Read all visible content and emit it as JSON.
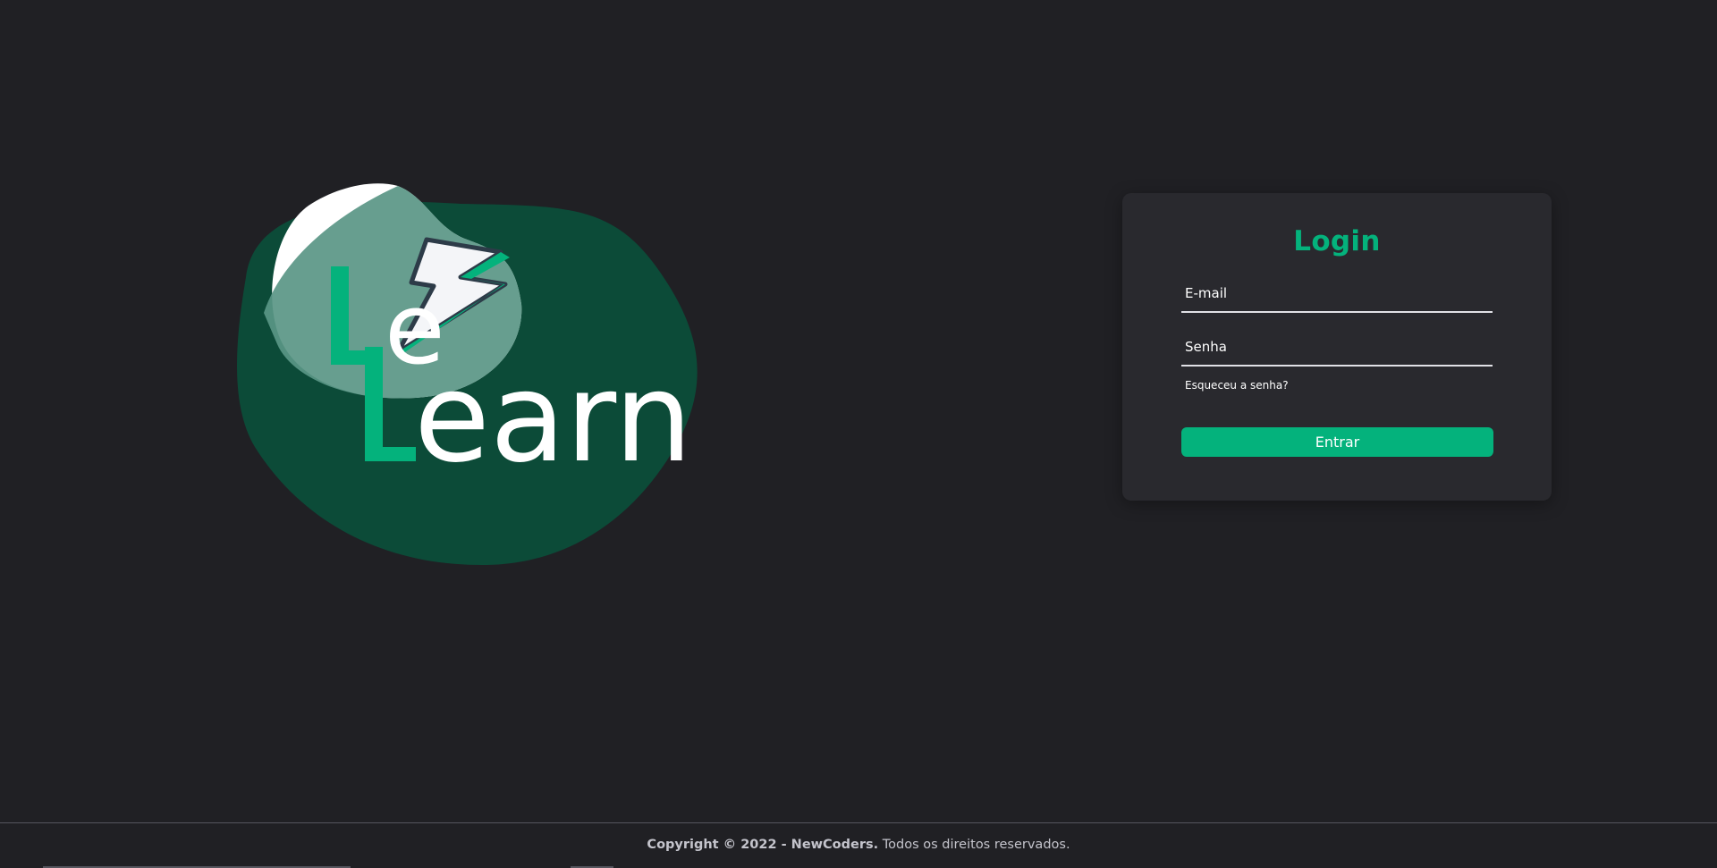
{
  "logo": {
    "line1": "Le",
    "line2": "Learn",
    "letter_L": "L",
    "word_earn": "earn",
    "word_e": "e"
  },
  "login": {
    "title": "Login",
    "email_placeholder": "E-mail",
    "password_placeholder": "Senha",
    "forgot_link": "Esqueceu a senha?",
    "submit_label": "Entrar"
  },
  "footer": {
    "copyright": "Copyright © 2022 - NewCoders.",
    "rights": " Todos os direitos reservados."
  },
  "colors": {
    "background": "#202024",
    "card": "#29292e",
    "accent": "#04b27c",
    "blob": "#0c4b38"
  }
}
